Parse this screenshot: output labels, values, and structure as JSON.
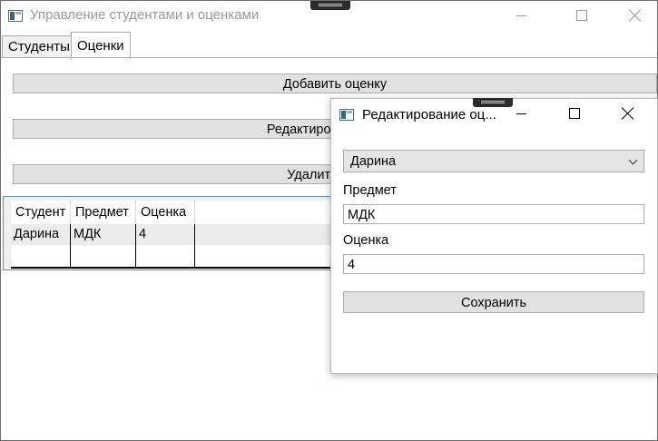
{
  "main_window": {
    "title": "Управление студентами и оценками",
    "tabs": [
      {
        "label": "Студенты",
        "selected": false
      },
      {
        "label": "Оценки",
        "selected": true
      }
    ],
    "buttons": {
      "add": "Добавить оценку",
      "edit": "Редактировать оценку",
      "delete": "Удалить оценку"
    },
    "grid": {
      "columns": [
        "Студент",
        "Предмет",
        "Оценка"
      ],
      "rows": [
        {
          "student": "Дарина",
          "subject": "МДК",
          "grade": "4"
        }
      ]
    }
  },
  "dialog": {
    "title": "Редактирование оц...",
    "student_combo": {
      "selected": "Дарина"
    },
    "subject_label": "Предмет",
    "subject_value": "МДК",
    "grade_label": "Оценка",
    "grade_value": "4",
    "save_label": "Сохранить"
  },
  "colors": {
    "button_face": "#e1e1e1",
    "grid_border": "#688caf",
    "inactive_title": "#9a9a9a"
  }
}
